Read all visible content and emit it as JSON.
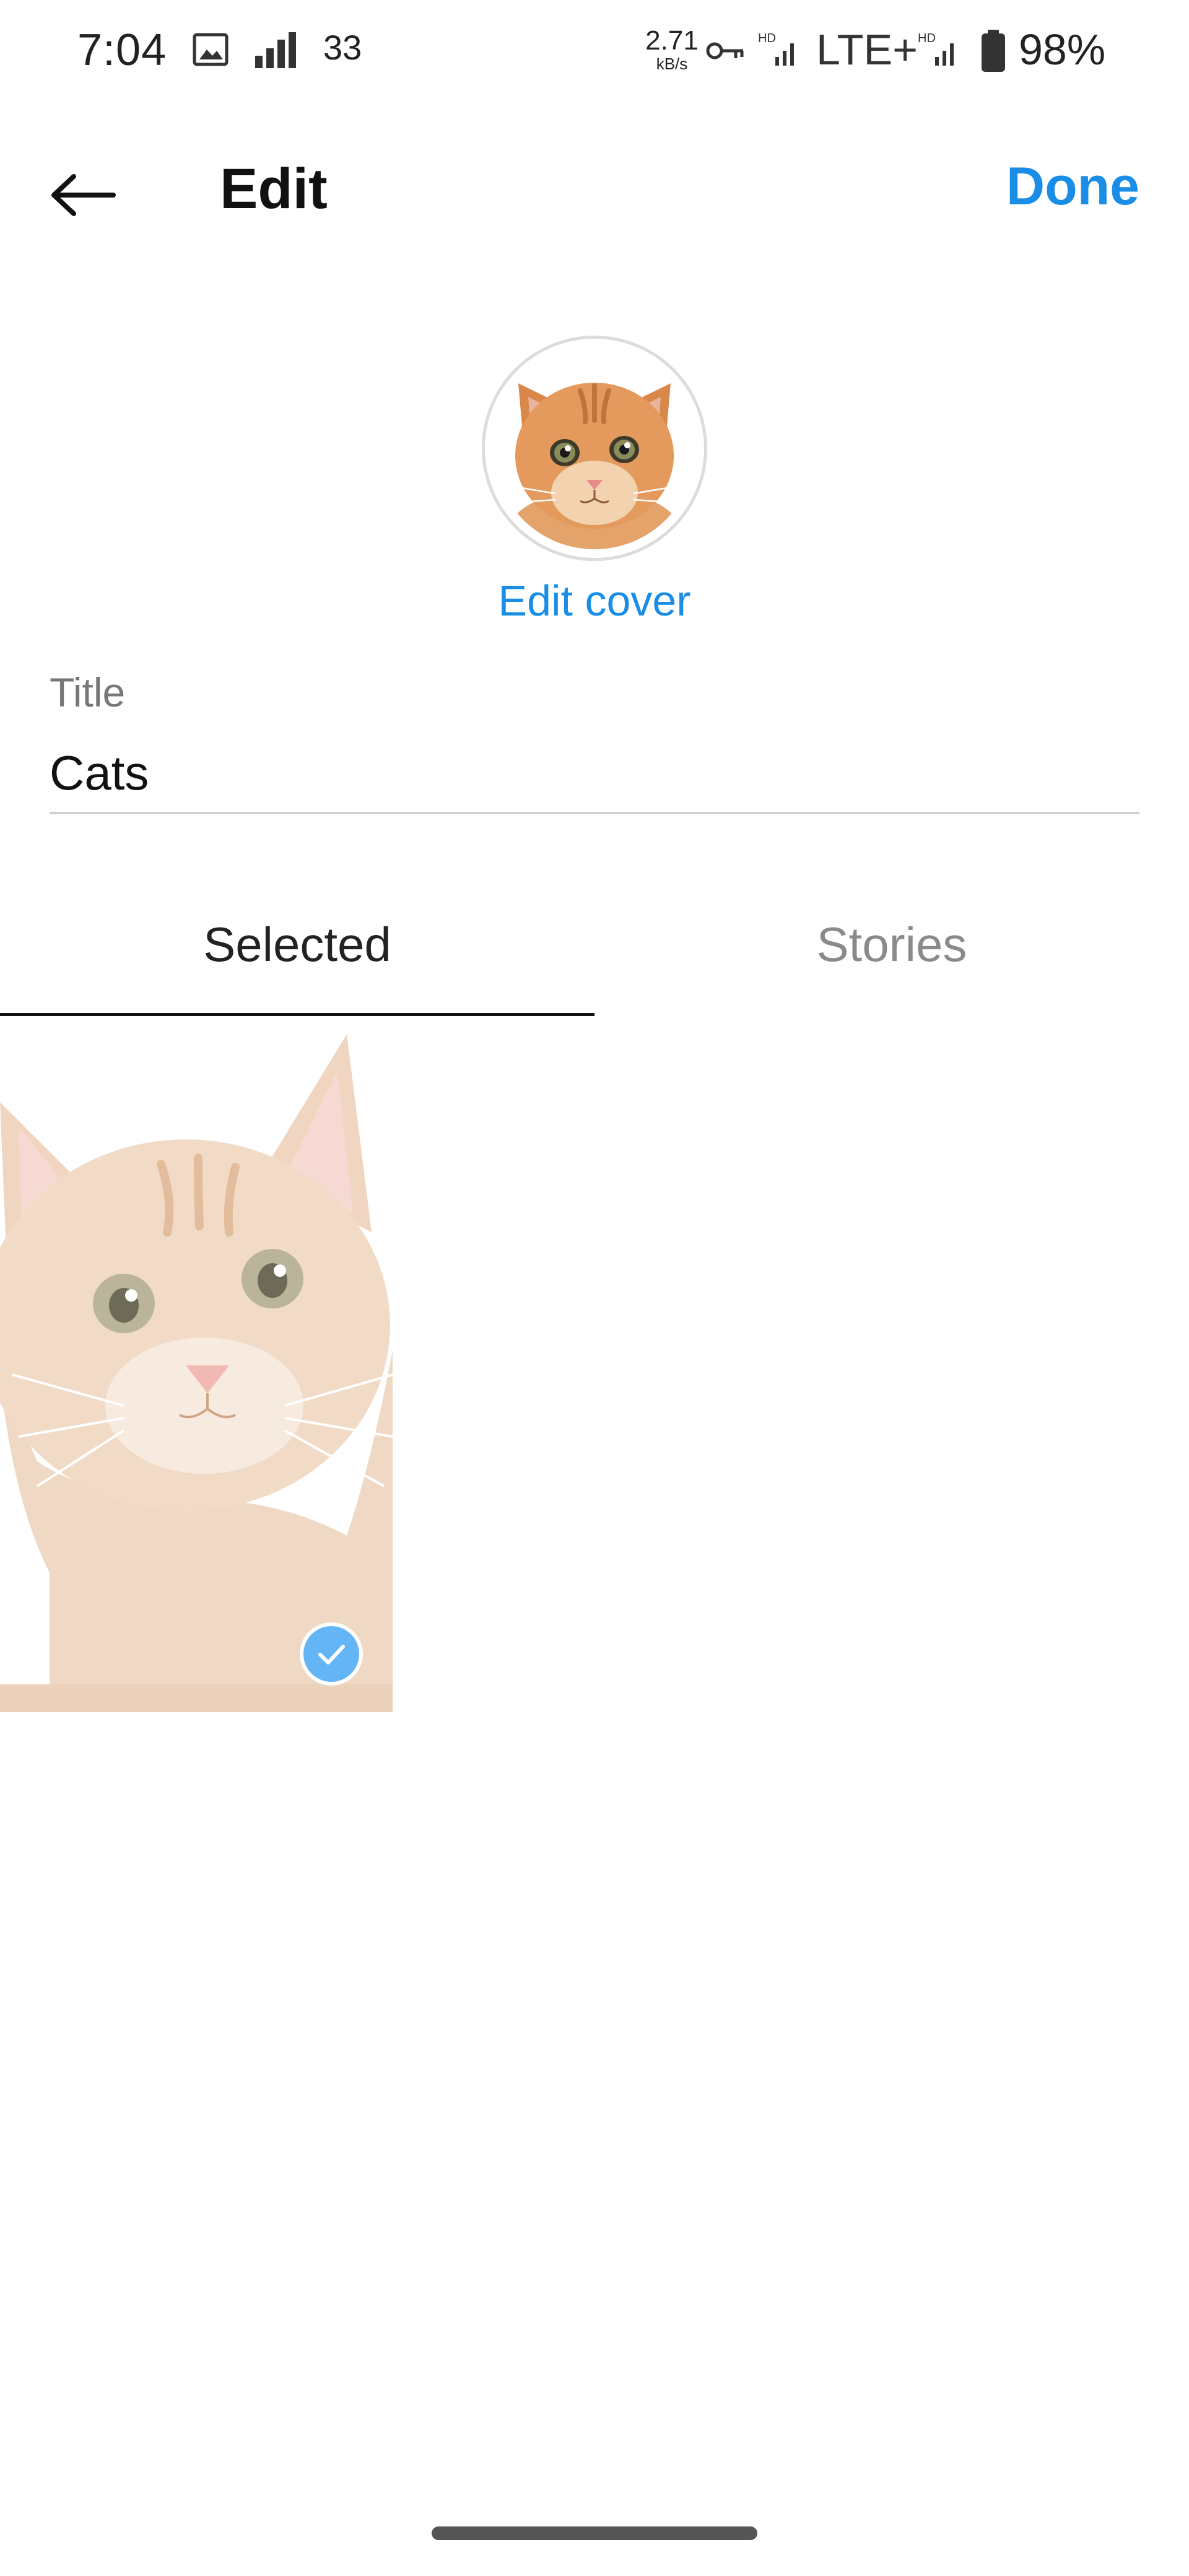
{
  "status_bar": {
    "time": "7:04",
    "notification_count": "33",
    "data_speed_value": "2.71",
    "data_speed_unit": "kB/s",
    "network_label": "LTE+",
    "battery_percent": "98%",
    "icons": [
      "gallery-icon",
      "signal-icon",
      "vpn-key-icon",
      "hd-signal-icon",
      "hd-signal-icon",
      "battery-icon"
    ]
  },
  "header": {
    "back_icon": "arrow-left-icon",
    "title": "Edit",
    "done_label": "Done"
  },
  "cover": {
    "image": "orange-kitten-face",
    "edit_label": "Edit cover"
  },
  "title_field": {
    "label": "Title",
    "value": "Cats"
  },
  "tabs": [
    {
      "label": "Selected",
      "active": true
    },
    {
      "label": "Stories",
      "active": false
    }
  ],
  "grid": {
    "items": [
      {
        "image": "orange-kitten",
        "selected": true
      }
    ]
  },
  "colors": {
    "accent": "#1a8ee6",
    "check_badge": "#64b5f6",
    "inactive_tab": "#8a8a8a"
  }
}
